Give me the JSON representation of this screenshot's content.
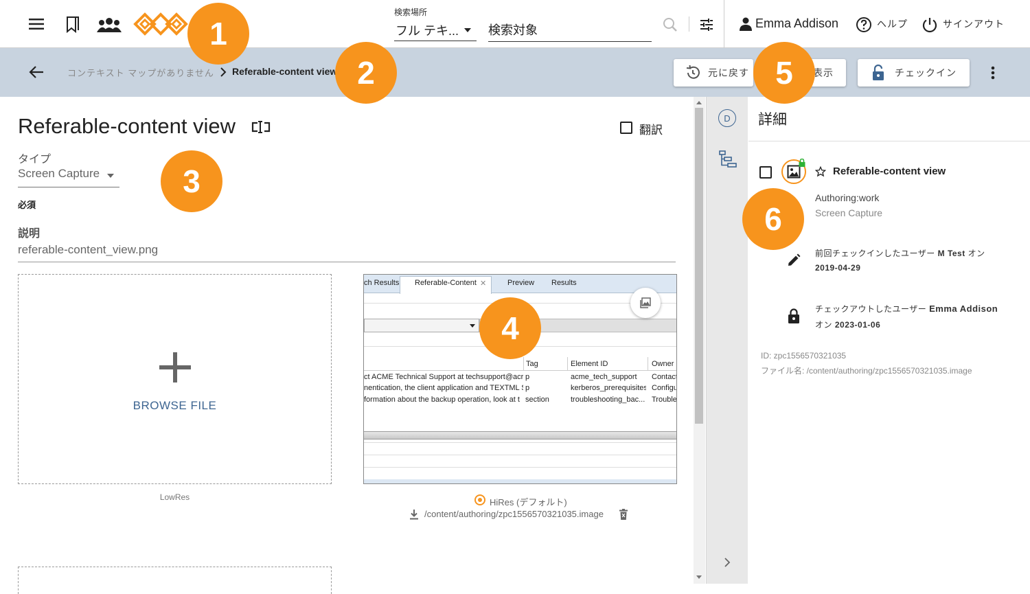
{
  "header": {
    "search_scope_label": "検索場所",
    "search_scope_value": "フル テキ...",
    "search_placeholder": "検索対象",
    "user_name": "Emma Addison",
    "help_label": "ヘルプ",
    "signout_label": "サインアウト"
  },
  "toolbar": {
    "breadcrumb_root": "コンテキスト マップがありません",
    "breadcrumb_current": "Referable-content view",
    "revert_label": "元に戻す",
    "view_label": "表示",
    "checkin_label": "チェックイン"
  },
  "main": {
    "title": "Referable-content view",
    "translate_label": "翻訳",
    "type_label": "タイプ",
    "type_value": "Screen Capture",
    "required_label": "必須",
    "description_label": "説明",
    "description_value": "referable-content_view.png",
    "browse_label": "BROWSE FILE",
    "lowres_label": "LowRes",
    "hires_label": "HiRes (デフォルト)",
    "hires_path": "/content/authoring/zpc1556570321035.image"
  },
  "preview": {
    "tabs": [
      "ch Results",
      "Referable-Content",
      "Preview",
      "Results"
    ],
    "columns": [
      "Tag",
      "Element ID",
      "Owner I"
    ],
    "rows": [
      [
        "ct ACME Technical Support at techsupport@acr",
        "p",
        "acme_tech_support",
        "Contact"
      ],
      [
        "nentication, the client application and TEXTML S",
        "p",
        "kerberos_prerequisites",
        "Configu"
      ],
      [
        "formation about the backup operation, look at t",
        "section",
        "troubleshooting_bac...",
        "Trouble"
      ]
    ]
  },
  "detail": {
    "title": "詳細",
    "rail_d": "D",
    "asset_title": "Referable-content view",
    "status": "Authoring:work",
    "type": "Screen Capture",
    "last_checkin_prefix": "前回チェックインしたユーザー",
    "last_checkin_user": "M Test",
    "last_checkin_on": "オン",
    "last_checkin_date": "2019-04-29",
    "checkout_prefix": "チェックアウトしたユーザー",
    "checkout_user": "Emma Addison",
    "checkout_on": "オン",
    "checkout_date": "2023-01-06",
    "id_line": "ID: zpc1556570321035",
    "filename_line": "ファイル名: /content/authoring/zpc1556570321035.image"
  },
  "callouts": [
    "1",
    "2",
    "3",
    "4",
    "5",
    "6"
  ],
  "colors": {
    "accent": "#f7941d",
    "toolbar_bg": "#c8d3df",
    "link": "#3d6591"
  },
  "icons": [
    "menu-icon",
    "bookmark-icon",
    "group-icon",
    "logo",
    "search-icon",
    "filter-icon",
    "person-icon",
    "help-icon",
    "power-icon",
    "back-arrow-icon",
    "chevron-right-icon",
    "history-icon",
    "lock-open-icon",
    "more-vert-icon",
    "compare-icon",
    "plus-icon",
    "image-icon",
    "download-icon",
    "trash-icon",
    "tree-icon",
    "chevron-right-icon",
    "star-icon",
    "pencil-icon",
    "lock-icon"
  ]
}
